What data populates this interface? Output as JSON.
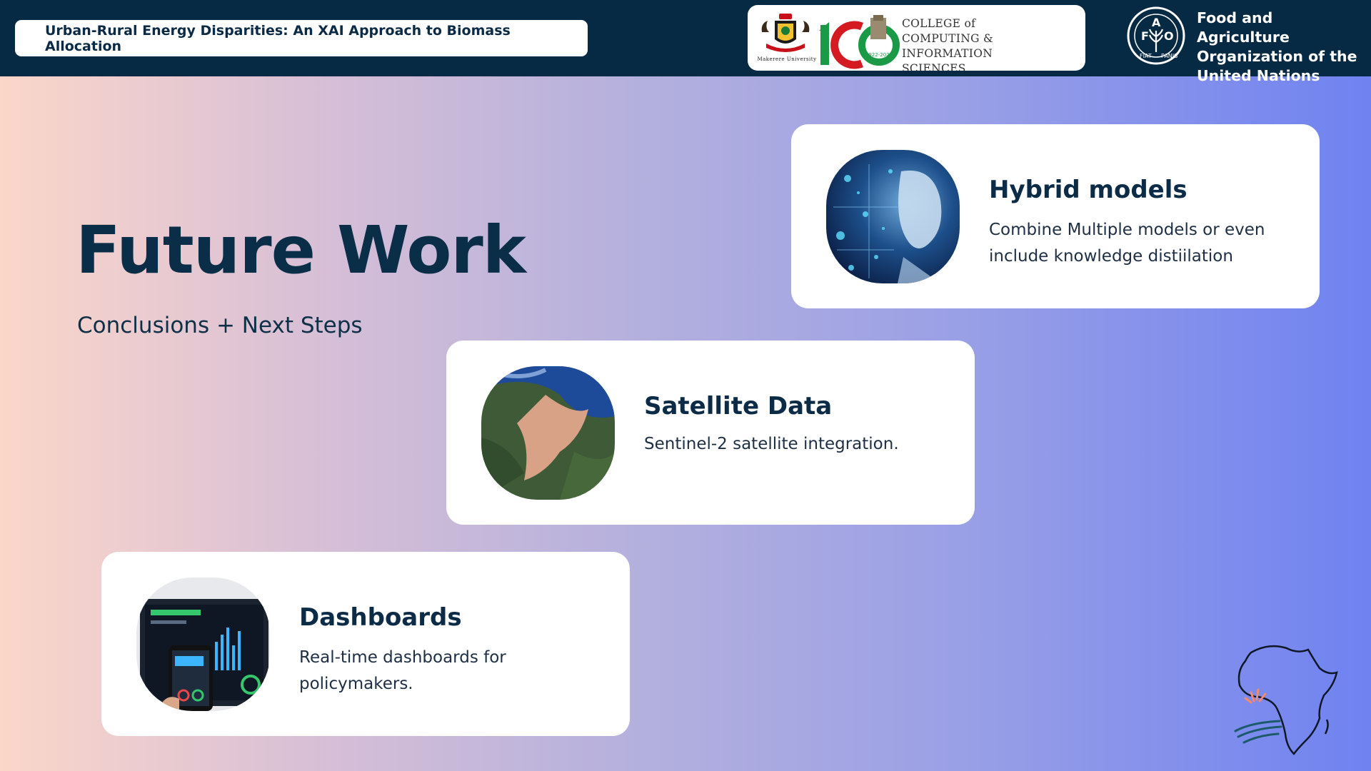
{
  "header": {
    "title": "Urban-Rural Energy Disparities: An XAI Approach to Biomass Allocation",
    "makerere_label": "Makerere University",
    "college_lines": [
      "COLLEGE of",
      "COMPUTING & INFORMATION",
      "SCIENCES"
    ],
    "fao_lines": [
      "Food and Agriculture",
      "Organization of the",
      "United Nations"
    ]
  },
  "hero": {
    "title": "Future Work",
    "subtitle": "Conclusions + Next Steps"
  },
  "cards": [
    {
      "title": "Hybrid models",
      "description": "Combine Multiple models or even include knowledge distiilation",
      "image": "ai-face-image"
    },
    {
      "title": "Satellite Data",
      "description": "Sentinel-2 satellite integration.",
      "image": "satellite-estuary-image"
    },
    {
      "title": "Dashboards",
      "description": "Real-time dashboards for policymakers.",
      "image": "dashboard-devices-image"
    }
  ],
  "colors": {
    "header_bg": "#062a43",
    "title_text": "#0a2d48",
    "gradient_left": "#fbd6c9",
    "gradient_right": "#6f82f0"
  }
}
